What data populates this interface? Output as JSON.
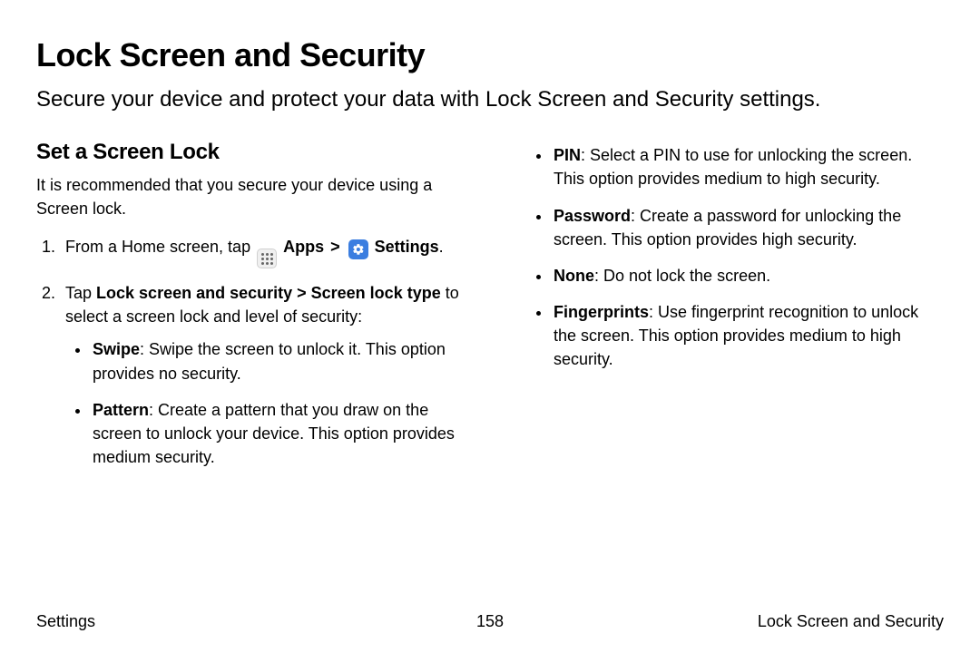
{
  "page": {
    "title": "Lock Screen and Security",
    "subtitle": "Secure your device and protect your data with Lock Screen and Security settings."
  },
  "section": {
    "heading": "Set a Screen Lock",
    "intro": "It is recommended that you secure your device using a Screen lock.",
    "step1": {
      "prefix": "From a Home screen, tap ",
      "apps_label": "Apps",
      "separator": ">",
      "settings_label": "Settings",
      "suffix": "."
    },
    "step2": {
      "prefix": "Tap ",
      "path_bold": "Lock screen and security > Screen lock type",
      "suffix": " to select a screen lock and level of security:"
    },
    "options_left": [
      {
        "name": "Swipe",
        "desc": ": Swipe the screen to unlock it. This option provides no security."
      },
      {
        "name": "Pattern",
        "desc": ": Create a pattern that you draw on the screen to unlock your device. This option provides medium security."
      }
    ],
    "options_right": [
      {
        "name": "PIN",
        "desc": ": Select a PIN to use for unlocking the screen. This option provides medium to high security."
      },
      {
        "name": "Password",
        "desc": ": Create a password for unlocking the screen. This option provides high security."
      },
      {
        "name": "None",
        "desc": ": Do not lock the screen."
      },
      {
        "name": "Fingerprints",
        "desc": ": Use fingerprint recognition to unlock the screen. This option provides medium to high security."
      }
    ]
  },
  "footer": {
    "left": "Settings",
    "center": "158",
    "right": "Lock Screen and Security"
  }
}
